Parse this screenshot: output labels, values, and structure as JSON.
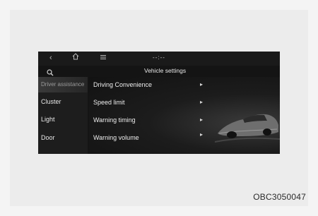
{
  "screen": {
    "time_display": "--:--",
    "title": "Vehicle settings",
    "sidebar": [
      {
        "label": "Driver assistance",
        "active": true
      },
      {
        "label": "Cluster",
        "active": false
      },
      {
        "label": "Light",
        "active": false
      },
      {
        "label": "Door",
        "active": false
      }
    ],
    "menu": [
      {
        "label": "Driving Convenience"
      },
      {
        "label": "Speed limit"
      },
      {
        "label": "Warning timing"
      },
      {
        "label": "Warning volume"
      }
    ]
  },
  "caption": "OBC3050047"
}
